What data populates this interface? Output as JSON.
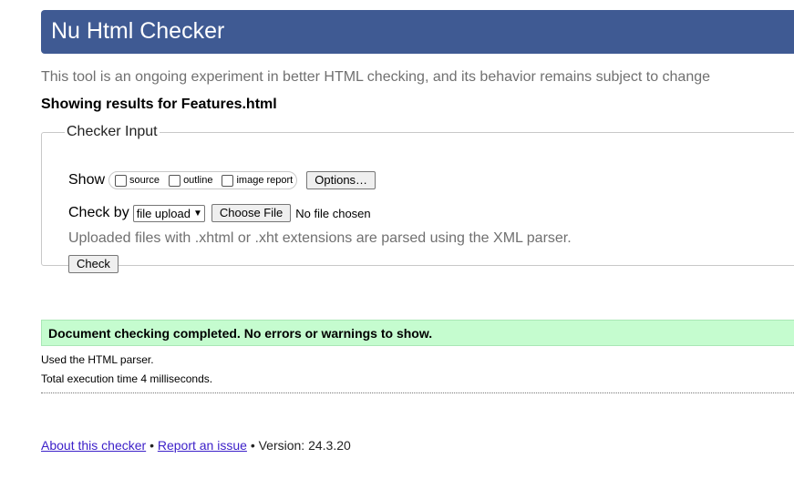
{
  "header": {
    "title": "Nu Html Checker"
  },
  "intro_text": "This tool is an ongoing experiment in better HTML checking, and its behavior remains subject to change",
  "showing_results": "Showing results for Features.html",
  "checker_input": {
    "legend": "Checker Input",
    "show_label": "Show",
    "show_options": [
      {
        "label": "source",
        "checked": false
      },
      {
        "label": "outline",
        "checked": false
      },
      {
        "label": "image report",
        "checked": false
      }
    ],
    "options_button": "Options…",
    "check_by_label": "Check by",
    "check_by_selected": "file upload",
    "choose_file_button": "Choose File",
    "no_file_text": "No file chosen",
    "xml_note": "Uploaded files with .xhtml or .xht extensions are parsed using the XML parser.",
    "check_button": "Check"
  },
  "result": {
    "message": "Document checking completed. No errors or warnings to show.",
    "parser_note": "Used the HTML parser.",
    "execution_time": "Total execution time 4 milliseconds."
  },
  "footer": {
    "about_link": "About this checker",
    "separator": "•",
    "report_link": "Report an issue",
    "version_text": "Version: 24.3.20"
  },
  "colors": {
    "header_bg": "#3f5a93",
    "result_bg": "#c5fccf",
    "link": "#3d21c9"
  }
}
